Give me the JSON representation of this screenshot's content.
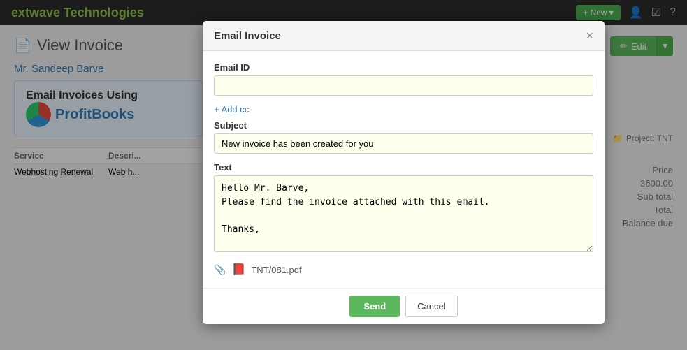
{
  "app": {
    "brand": "extwave Technologies",
    "navbar": {
      "new_btn": "+ New ▾",
      "icons": [
        "👤",
        "☑",
        "?"
      ]
    }
  },
  "page": {
    "title": "View Invoice",
    "title_icon": "📄",
    "edit_btn": "Edit",
    "customer_name": "Mr. Sandeep Barve",
    "promo": {
      "text": "Email Invoices Using",
      "logo_text": "ProfitBooks"
    },
    "project_tag": "Project: TNT",
    "table": {
      "headers": [
        "Service",
        "Descri..."
      ],
      "rows": [
        {
          "service": "Webhosting Renewal",
          "desc": "Web h..."
        }
      ]
    },
    "totals": {
      "price_header": "Price",
      "price_value": "3600.00",
      "subtotal_label": "Sub total",
      "total_label": "Total",
      "balance_due_label": "Balance due"
    }
  },
  "modal": {
    "title": "Email Invoice",
    "close_label": "×",
    "email_id_label": "Email ID",
    "email_id_placeholder": "",
    "email_id_value": "",
    "add_cc_label": "+ Add cc",
    "subject_label": "Subject",
    "subject_value": "New invoice has been created for you",
    "text_label": "Text",
    "text_value": "Hello Mr. Barve,\nPlease find the invoice attached with this email.\n\nThanks,",
    "attachment_file": "TNT/081.pdf",
    "send_btn": "Send",
    "cancel_btn": "Cancel"
  }
}
